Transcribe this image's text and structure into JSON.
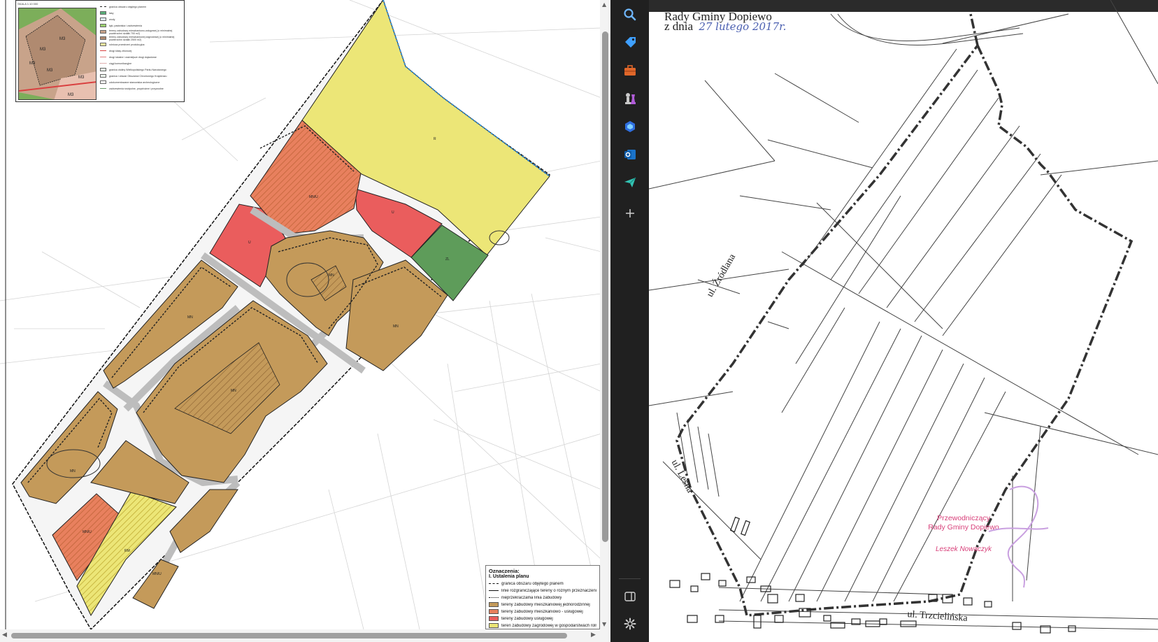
{
  "map": {
    "inset": {
      "scale": "SKALA 1:10 000",
      "zone_labels": [
        "M3",
        "M3",
        "M3",
        "M3",
        "M3",
        "M3"
      ],
      "items": [
        "granica obszaru objętego planem",
        "lasy",
        "wody",
        "łąki, pastwiska i zadrzewienia",
        "tereny zabudowy mieszkaniowo-usługowej (o minimalnej powierzchni działki 700 m2)",
        "tereny zabudowy mieszkaniowej zagrodowej (o minimalnej powierzchni działki 2500 m2)",
        "rolnicza przestrzeń produkcyjna",
        "drogi klasy zbiorczej",
        "drogi lokalne i ważniejsze drogi dojazdowe",
        "ciągi komunikacyjne",
        "granica otuliny Wielkopolskiego Parku Narodowego",
        "granica i obszar Obszarów Chronionego Krajobrazu",
        "udokumentowane stanowiska archeologiczne",
        "zadrzewienia śródpolne, przydrożne i przywodne"
      ]
    },
    "parcel_labels": [
      "MN",
      "MN",
      "MN",
      "MN",
      "MN/U",
      "MN/U",
      "U",
      "U",
      "ZL",
      "R",
      "RM",
      "MN",
      "MN/U"
    ],
    "legend": {
      "title": "Oznaczenia:",
      "subtitle": "I. Ustalenia planu",
      "items": [
        "granica obszaru objętego planem",
        "linie rozgraniczające tereny o różnym przeznaczeniu lub różnych zasadach zagospodarowania",
        "nieprzekraczalna linia zabudowy",
        "tereny zabudowy mieszkaniowej jednorodzinnej",
        "tereny zabudowy mieszkaniowo - usługowej",
        "tereny zabudowy usługowej",
        "teren zabudowy zagrodowej w gospodarstwach rolnych"
      ]
    }
  },
  "sidebar": {
    "buttons": [
      "search",
      "tag",
      "toolbox",
      "chess",
      "copilot",
      "outlook",
      "send",
      "add"
    ],
    "bottom": [
      "sidebar-toggle",
      "settings"
    ]
  },
  "document": {
    "header_line1": "Rady Gminy Dopiewo",
    "date_prefix": "z dnia",
    "date_hand": "27 lutego 2017r.",
    "streets": {
      "zrodlana": "ul. Źródlana",
      "lesna": "ul. Leśna",
      "trzcielinska": "ul. Trzcielińska"
    },
    "stamp": {
      "line1": "Przewodniczący",
      "line2": "Rady Gminy Dopiewo",
      "name": "Leszek Nowaczyk"
    }
  },
  "colors": {
    "residential": "#c49a5a",
    "residential_service": "#e8805e",
    "service": "#ea5d5d",
    "agricultural": "#ece677",
    "forest": "#5e9c5a",
    "sidebar_bg": "#202020"
  }
}
